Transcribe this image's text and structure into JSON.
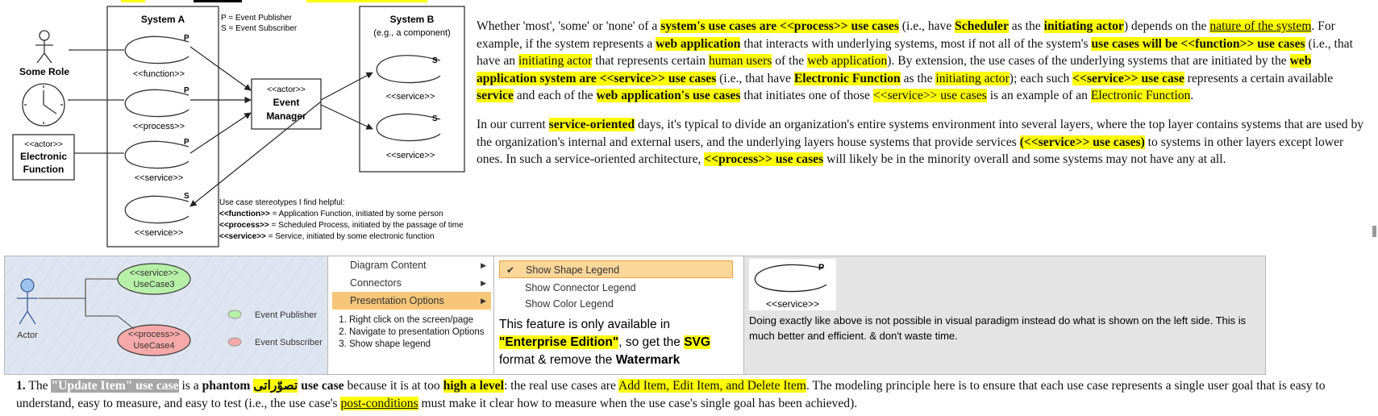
{
  "uml": {
    "system_a_title": "System A",
    "system_b_title": "System B",
    "system_b_subtitle": "(e.g., a component)",
    "legend_p": "P = Event Publisher",
    "legend_s": "S = Event Subscriber",
    "actor_some_role": "Some Role",
    "actor_stereotype": "<<actor>>",
    "actor_electronic_line1": "Electronic",
    "actor_electronic_line2": "Function",
    "event_manager_stereotype": "<<actor>>",
    "event_manager_line1": "Event",
    "event_manager_line2": "Manager",
    "usecase_function": "<<function>>",
    "usecase_process": "<<process>>",
    "usecase_service": "<<service>>",
    "marker_p": "P",
    "marker_s": "S",
    "note_title": "Use case stereotypes I find helpful:",
    "note_function_key": "<<function>>",
    "note_function_desc": " = Application Function, initiated by some person",
    "note_process_key": "<<process>>",
    "note_process_desc": " = Scheduled Process, initiated by the passage of time",
    "note_service_key": "<<service>>",
    "note_service_desc": " = Service, initiated by some electronic function"
  },
  "para1": [
    {
      "t": "Whether 'most', 'some' or 'none' of a ",
      "s": ""
    },
    {
      "t": "system's use cases are <<process>> use cases",
      "s": "hl b"
    },
    {
      "t": " (i.e., have ",
      "s": ""
    },
    {
      "t": "Scheduler",
      "s": "hl b"
    },
    {
      "t": " as the ",
      "s": ""
    },
    {
      "t": "initiating actor",
      "s": "hl b"
    },
    {
      "t": ") depends on the ",
      "s": ""
    },
    {
      "t": "nature of the system",
      "s": "hl u"
    },
    {
      "t": ". For example, if the system represents a ",
      "s": ""
    },
    {
      "t": "web application",
      "s": "hl b"
    },
    {
      "t": " that interacts with underlying systems, most if not all of the system's ",
      "s": ""
    },
    {
      "t": "use cases will be <<function>> use cases",
      "s": "hl b"
    },
    {
      "t": " (i.e., that have an ",
      "s": ""
    },
    {
      "t": "initiating actor",
      "s": "hl"
    },
    {
      "t": " that represents certain ",
      "s": ""
    },
    {
      "t": "human users",
      "s": "hl"
    },
    {
      "t": " of the ",
      "s": ""
    },
    {
      "t": "web application",
      "s": "hl"
    },
    {
      "t": "). By extension, the use cases of the underlying systems that are initiated by the ",
      "s": ""
    },
    {
      "t": "web application system are <<service>> use cases",
      "s": "hl b"
    },
    {
      "t": " (i.e., that have ",
      "s": ""
    },
    {
      "t": "Electronic Function",
      "s": "hl b"
    },
    {
      "t": " as the ",
      "s": ""
    },
    {
      "t": "initiating actor",
      "s": "hl"
    },
    {
      "t": "); each such ",
      "s": ""
    },
    {
      "t": "<<service>> use case",
      "s": "hl b"
    },
    {
      "t": " represents a certain available ",
      "s": ""
    },
    {
      "t": "service",
      "s": "hl b"
    },
    {
      "t": " and each of the ",
      "s": ""
    },
    {
      "t": "web application's use cases",
      "s": "hl b"
    },
    {
      "t": " that initiates one of those ",
      "s": ""
    },
    {
      "t": "<<service>> use cases",
      "s": "hl"
    },
    {
      "t": " is an example of an ",
      "s": ""
    },
    {
      "t": "Electronic Function",
      "s": "hl"
    },
    {
      "t": ".",
      "s": ""
    }
  ],
  "para2": [
    {
      "t": "In our current ",
      "s": ""
    },
    {
      "t": "service-oriented",
      "s": "hl b"
    },
    {
      "t": " days, it's typical to divide an organization's entire systems environment into several layers, where the top layer contains systems that are used by the organization's internal and external users, and the underlying layers house systems that provide services ",
      "s": ""
    },
    {
      "t": "(<<service>> use cases)",
      "s": "hl b"
    },
    {
      "t": " to systems in other layers except lower ones. In such a service-oriented architecture, ",
      "s": ""
    },
    {
      "t": "<<process>> use cases",
      "s": "hl b"
    },
    {
      "t": " will likely be in the minority overall and some systems may not have any at all.",
      "s": ""
    }
  ],
  "panel1": {
    "service_stereo": "<<service>>",
    "service_name": "UseCase3",
    "process_stereo": "<<process>>",
    "process_name": "UseCase4",
    "actor_label": "Actor",
    "legend_publisher": "Event Publisher",
    "legend_subscriber": "Event Subscriber",
    "publisher_color": "#b6f0a8",
    "subscriber_color": "#f7a9a9"
  },
  "panel2": {
    "menu": [
      "Diagram Content",
      "Connectors",
      "Presentation Options"
    ],
    "steps": [
      "Right click on the screen/page",
      "Navigate to presentation Options",
      "Show shape legend"
    ]
  },
  "panel3": {
    "options": [
      "Show Shape Legend",
      "Show Connector Legend",
      "Show Color Legend"
    ],
    "feature": [
      {
        "t": "This feature is only available in ",
        "s": ""
      },
      {
        "t": "\"Enterprise Edition\"",
        "s": "hl b"
      },
      {
        "t": ", so get the ",
        "s": ""
      },
      {
        "t": "SVG",
        "s": "hl b"
      },
      {
        "t": " format & remove the ",
        "s": ""
      },
      {
        "t": "Watermark",
        "s": "b"
      }
    ]
  },
  "panel4": {
    "marker": "P",
    "stereo": "<<service>>",
    "note": "Doing exactly like above is not possible in visual paradigm instead do what is shown  on the left side. This is much better and efficient. & don't waste time."
  },
  "bottom": {
    "number": "1.",
    "segments": [
      {
        "t": " The ",
        "s": ""
      },
      {
        "t": "\"Update Item\" use case",
        "s": "gray"
      },
      {
        "t": " is a ",
        "s": ""
      },
      {
        "t": "phantom",
        "s": "b"
      },
      {
        "t": " ",
        "s": ""
      },
      {
        "t": "تصوّراتی",
        "s": "hl b"
      },
      {
        "t": " use case",
        "s": "b"
      },
      {
        "t": " because it is at too ",
        "s": ""
      },
      {
        "t": "high a level",
        "s": "hl b"
      },
      {
        "t": ": the real use cases are ",
        "s": ""
      },
      {
        "t": "Add Item, Edit Item, and Delete Item",
        "s": "hl"
      },
      {
        "t": ". The modeling principle here is to ensure that each use case represents a single user goal that is easy to understand, easy to measure, and easy to test (i.e., the use case's ",
        "s": ""
      },
      {
        "t": "post-conditions",
        "s": "hl u"
      },
      {
        "t": " must make it clear how to measure when the use case's single goal has been achieved).",
        "s": ""
      }
    ]
  }
}
